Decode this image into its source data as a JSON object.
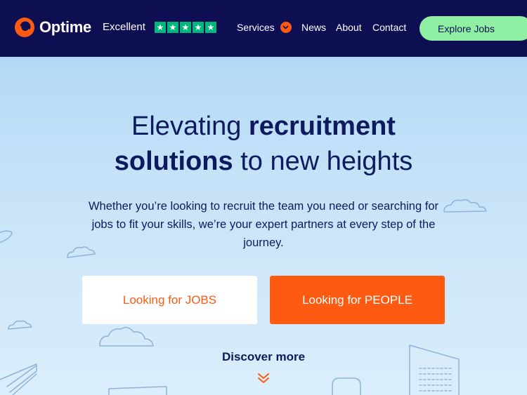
{
  "header": {
    "logo_text": "Optime",
    "rating_label": "Excellent",
    "rating_stars": 5,
    "nav": {
      "services": "Services",
      "news": "News",
      "about": "About",
      "contact": "Contact"
    },
    "explore_button": "Explore Jobs"
  },
  "hero": {
    "title_line1_light": "Elevating ",
    "title_line1_bold": "recruitment",
    "title_line2_bold": "solutions",
    "title_line2_light": " to new heights",
    "subtitle": "Whether you’re looking to recruit the team you need or searching for jobs to fit your skills, we’re your expert partners at every step of the journey.",
    "jobs_button": "Looking for JOBS",
    "people_button": "Looking for PEOPLE",
    "discover": "Discover more"
  },
  "icons": {
    "logo": "optime-logo-icon",
    "star": "star-icon",
    "services_chevron": "chevron-down-icon",
    "discover_chevron": "double-chevron-down-icon"
  },
  "colors": {
    "header_bg": "#0e0f52",
    "accent_orange": "#ff5a12",
    "explore_green": "#8ff0a4",
    "trustpilot_green": "#00b67a",
    "text_navy": "#0d1b5e"
  }
}
